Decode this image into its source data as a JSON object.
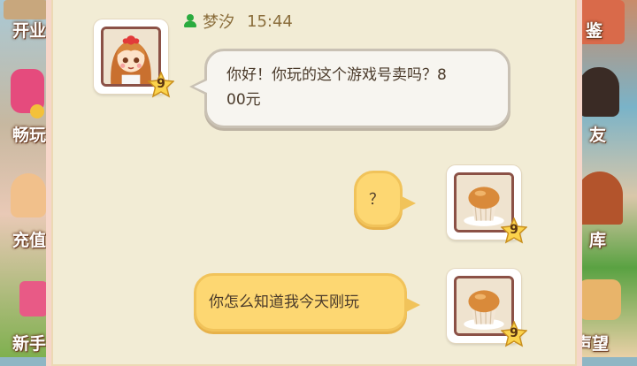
{
  "side_menu_left": [
    {
      "label": "开业",
      "icon": "shop-icon"
    },
    {
      "label": "畅玩",
      "icon": "gift-icon"
    },
    {
      "label": "充值",
      "icon": "character-icon"
    },
    {
      "label": "新手",
      "icon": "gift-box-icon"
    }
  ],
  "side_menu_right": [
    {
      "label": "鉴",
      "icon": "book-icon"
    },
    {
      "label": "友",
      "icon": "friend-icon"
    },
    {
      "label": "库",
      "icon": "storage-icon"
    },
    {
      "label": "声望",
      "icon": "reputation-icon"
    }
  ],
  "chat": {
    "header": {
      "sender_name": "梦汐",
      "time": "15:44"
    },
    "messages": [
      {
        "side": "left",
        "avatar": "girl-avatar",
        "level": "9",
        "text_line1": "你好！你玩的这个游戏号卖吗？8",
        "text_line2": "00元"
      },
      {
        "side": "right",
        "avatar": "muffin-avatar",
        "level": "9",
        "text": "？"
      },
      {
        "side": "right",
        "avatar": "muffin-avatar",
        "level": "9",
        "text": "你怎么知道我今天刚玩"
      }
    ]
  },
  "colors": {
    "panel_bg": "#f2ecd5",
    "bubble_gray": "#f7f5f0",
    "bubble_yellow": "#fdd772",
    "online_green": "#2bab3f",
    "name_text": "#8a6d3b"
  }
}
